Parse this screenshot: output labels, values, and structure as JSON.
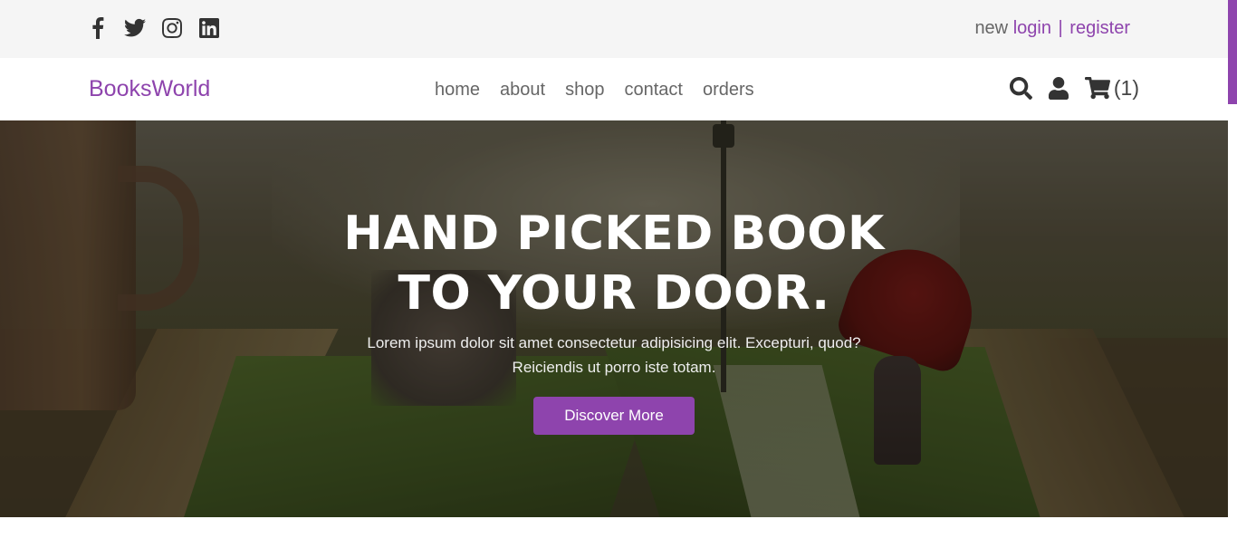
{
  "topbar": {
    "social_icons": [
      "facebook-icon",
      "twitter-icon",
      "instagram-icon",
      "linkedin-icon"
    ],
    "auth": {
      "prefix": "new",
      "login_label": "login",
      "separator": "|",
      "register_label": "register"
    }
  },
  "header": {
    "logo": "BooksWorld",
    "nav": [
      "home",
      "about",
      "shop",
      "contact",
      "orders"
    ],
    "icons": [
      "search-icon",
      "user-icon",
      "cart-icon"
    ],
    "cart_count": "(1)"
  },
  "hero": {
    "title_line1": "HAND PICKED BOOK",
    "title_line2": "TO YOUR DOOR.",
    "text": "Lorem ipsum dolor sit amet consectetur adipisicing elit. Excepturi, quod? Reiciendis ut porro iste totam.",
    "button_label": "Discover More"
  },
  "colors": {
    "accent": "#8e44ad",
    "topbar_bg": "#f5f5f5",
    "text": "#666666"
  }
}
